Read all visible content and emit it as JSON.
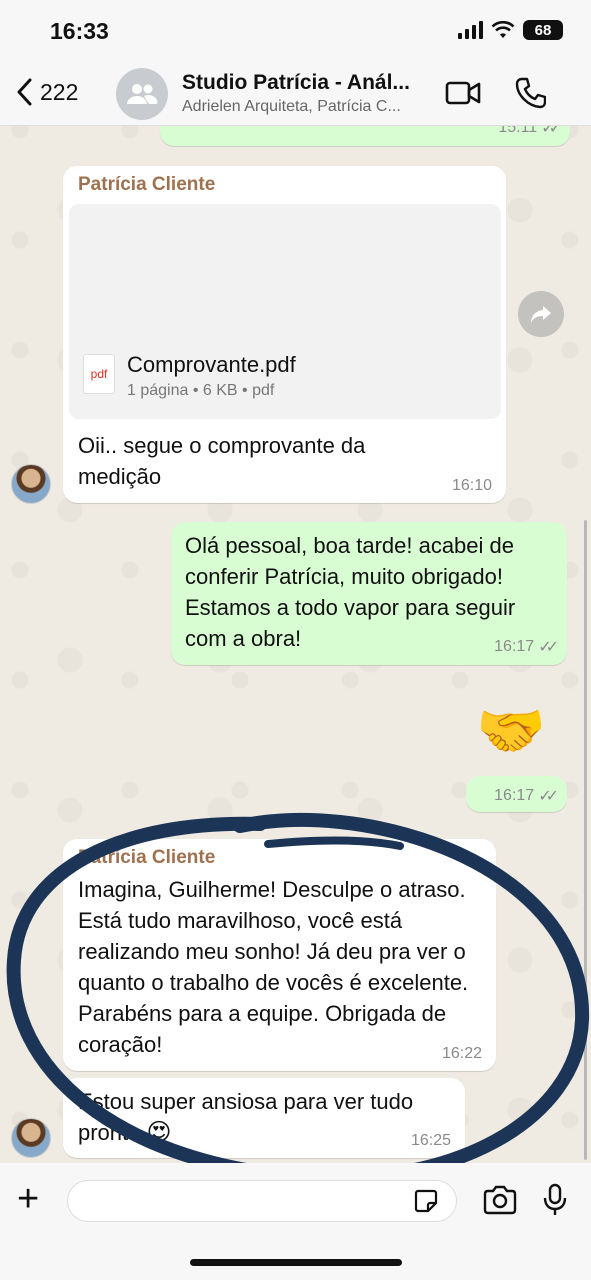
{
  "status_bar": {
    "time": "16:33",
    "battery": "68"
  },
  "header": {
    "back_count": "222",
    "title": "Studio Patrícia - Anál...",
    "subtitle": "Adrielen Arquiteta, Patrícia C..."
  },
  "messages": {
    "top_partial_time": "15:11",
    "doc_message": {
      "sender": "Patrícia Cliente",
      "doc_name": "Comprovante.pdf",
      "doc_meta": "1 página • 6 KB • pdf",
      "doc_icon_label": "pdf",
      "text": "Oii.. segue o comprovante da medição",
      "time": "16:10"
    },
    "out_message": {
      "text": "Olá pessoal, boa tarde! acabei de conferir Patrícia, muito obrigado! Estamos a todo vapor para seguir com a obra!",
      "time": "16:17"
    },
    "handshake": {
      "emoji": "🤝",
      "time": "16:17"
    },
    "reply_message": {
      "sender": "Patrícia Cliente",
      "text": "Imagina, Guilherme! Desculpe o atraso. Está tudo maravilhoso, você está realizando meu sonho! Já deu pra ver o quanto o trabalho de vocês é excelente. Parabéns para a equipe. Obrigada de coração!",
      "time": "16:22"
    },
    "last_message": {
      "text": "Estou super ansiosa para ver tudo pronto",
      "emoji": "😍",
      "time": "16:25"
    }
  },
  "colors": {
    "out_bubble": "#d9fdd3",
    "sender": "#a0714f",
    "annotation_ink": "#1c3557"
  }
}
